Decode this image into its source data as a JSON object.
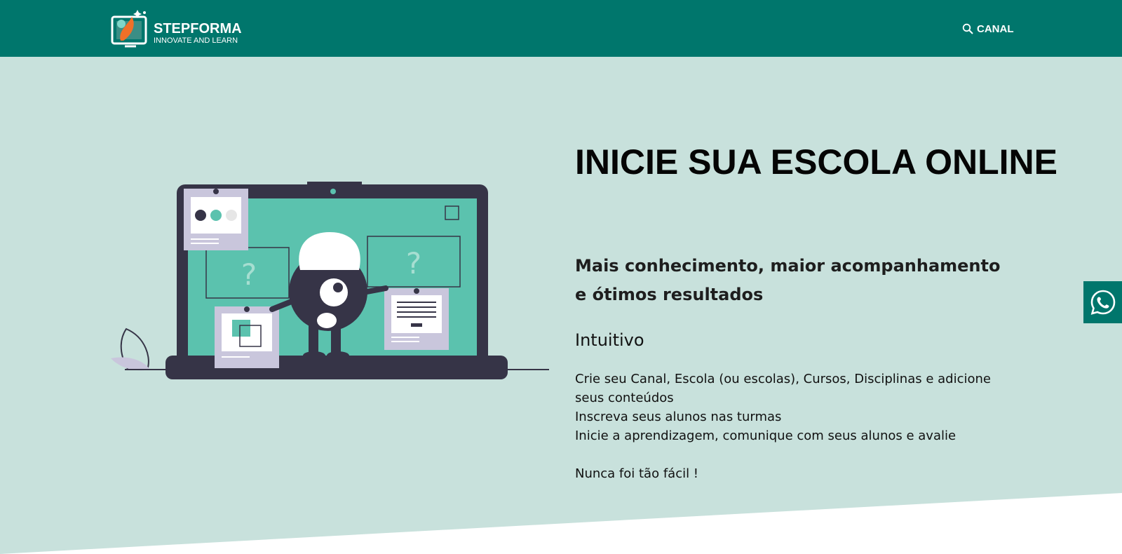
{
  "header": {
    "brand_name": "STEPFORMA",
    "brand_tagline": "INNOVATE AND LEARN",
    "nav_link": "CANAL"
  },
  "hero": {
    "title": "INICIE SUA ESCOLA ONLINE",
    "subtitle": "Mais conhecimento, maior acompanhamento e ótimos resultados",
    "feature_title": "Intuitivo",
    "feature_lines": [
      "Crie seu Canal,  Escola (ou escolas), Cursos, Disciplinas e adicione seus conteúdos",
      "Inscreva seus alunos nas turmas",
      "Inicie a aprendizagem, comunique com seus alunos e avalie",
      "Nunca foi tão fácil !"
    ]
  },
  "colors": {
    "header_bg": "#00766c",
    "hero_bg": "#c8e1dc",
    "illustration_accent": "#5bc2ae",
    "illustration_dark": "#363447",
    "whatsapp_bg": "#00766c"
  },
  "icons": {
    "nav": "search-icon",
    "floating": "whatsapp-icon"
  }
}
